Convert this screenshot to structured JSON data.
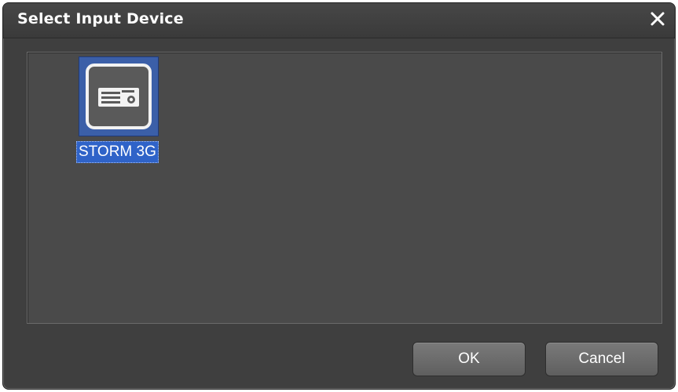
{
  "window": {
    "title": "Select Input Device",
    "close_icon": "close-icon"
  },
  "devices": [
    {
      "label": "STORM 3G",
      "icon": "hardware-device-icon",
      "selected": true
    }
  ],
  "buttons": {
    "ok_label": "OK",
    "cancel_label": "Cancel"
  },
  "colors": {
    "dialog_background": "#3f3f3f",
    "panel_background": "#4a4a4a",
    "selection_highlight": "#2f63c8",
    "button_background": "#6b6b6b",
    "text": "#ffffff"
  }
}
